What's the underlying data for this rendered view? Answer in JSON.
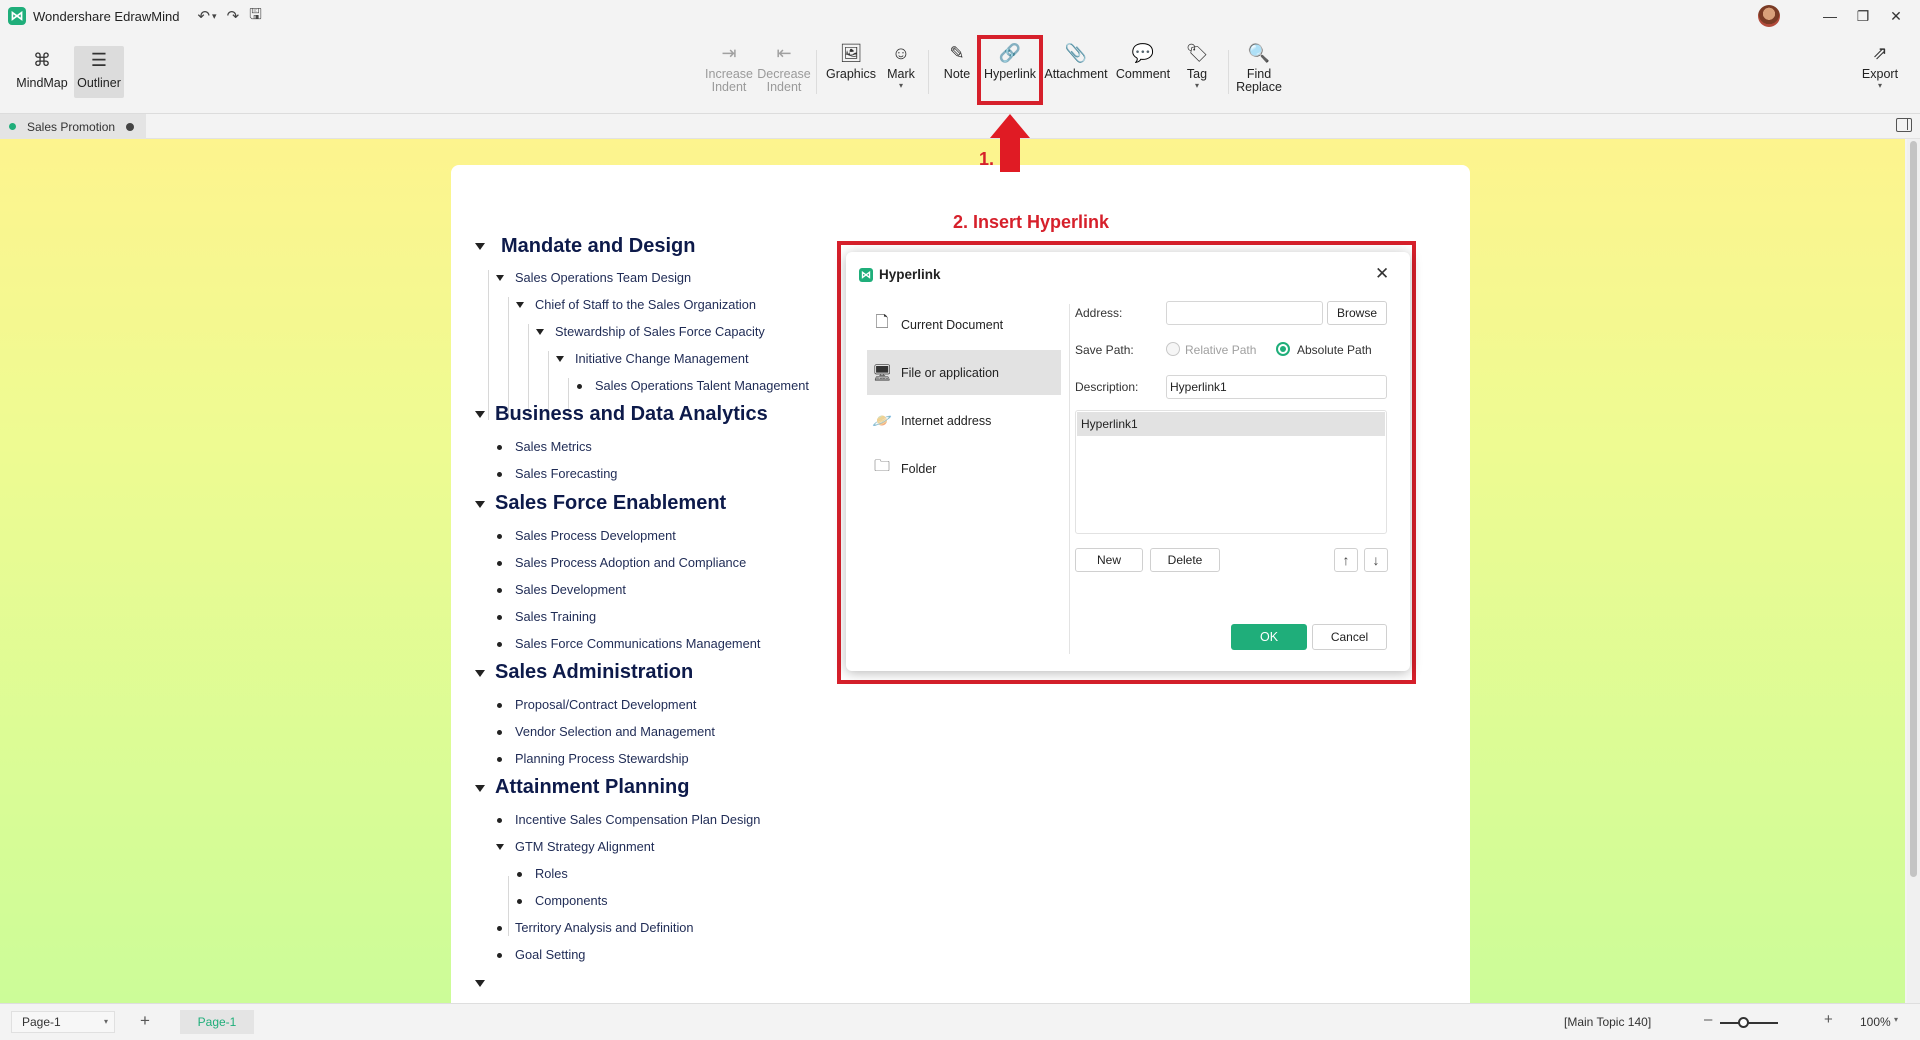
{
  "app": {
    "title": "Wondershare EdrawMind"
  },
  "ribbon": {
    "mindmap": "MindMap",
    "outliner": "Outliner",
    "increase_indent_1": "Increase",
    "increase_indent_2": "Indent",
    "decrease_indent_1": "Decrease",
    "decrease_indent_2": "Indent",
    "graphics": "Graphics",
    "mark": "Mark",
    "note": "Note",
    "hyperlink": "Hyperlink",
    "attachment": "Attachment",
    "comment": "Comment",
    "tag": "Tag",
    "find_replace_1": "Find",
    "find_replace_2": "Replace",
    "export": "Export"
  },
  "tabs": {
    "document": "Sales Promotion"
  },
  "annotations": {
    "step1": "1.",
    "step2": "2. Insert Hyperlink",
    "color": "#d6202b"
  },
  "outline": {
    "t1": "Mandate and Design",
    "t1_1": "Sales Operations Team Design",
    "t1_2": "Chief of Staff to the Sales Organization",
    "t1_3": "Stewardship of Sales Force Capacity",
    "t1_4": "Initiative Change Management",
    "t1_5": "Sales Operations Talent Management",
    "t2": "Business and Data Analytics",
    "t2_1": "Sales Metrics",
    "t2_2": "Sales Forecasting",
    "t3": "Sales Force Enablement",
    "t3_1": "Sales Process Development",
    "t3_2": "Sales Process Adoption and Compliance",
    "t3_3": "Sales Development",
    "t3_4": "Sales Training",
    "t3_5": "Sales Force Communications Management",
    "t4": "Sales Administration",
    "t4_1": "Proposal/Contract Development",
    "t4_2": "Vendor Selection and Management",
    "t4_3": "Planning Process Stewardship",
    "t5": "Attainment Planning",
    "t5_1": "Incentive Sales Compensation Plan Design",
    "t5_2": "GTM Strategy Alignment",
    "t5_3": "Roles",
    "t5_4": "Components",
    "t5_5": "Territory Analysis and Definition",
    "t5_6": "Goal Setting"
  },
  "dialog": {
    "title": "Hyperlink",
    "nav": [
      "Current Document",
      "File or application",
      "Internet address",
      "Folder"
    ],
    "address_label": "Address:",
    "address_value": "",
    "browse": "Browse",
    "save_path_label": "Save Path:",
    "relative_path": "Relative Path",
    "absolute_path": "Absolute Path",
    "description_label": "Description:",
    "description_value": "Hyperlink1",
    "list_items": [
      "Hyperlink1"
    ],
    "new": "New",
    "delete": "Delete",
    "ok": "OK",
    "cancel": "Cancel"
  },
  "status": {
    "page_select": "Page-1",
    "page_tab": "Page-1",
    "selection": "[Main Topic 140]",
    "zoom": "100%"
  },
  "colors": {
    "brand": "#1fae7a",
    "annotation": "#d6202b",
    "topic_text": "#0d1a4a"
  }
}
